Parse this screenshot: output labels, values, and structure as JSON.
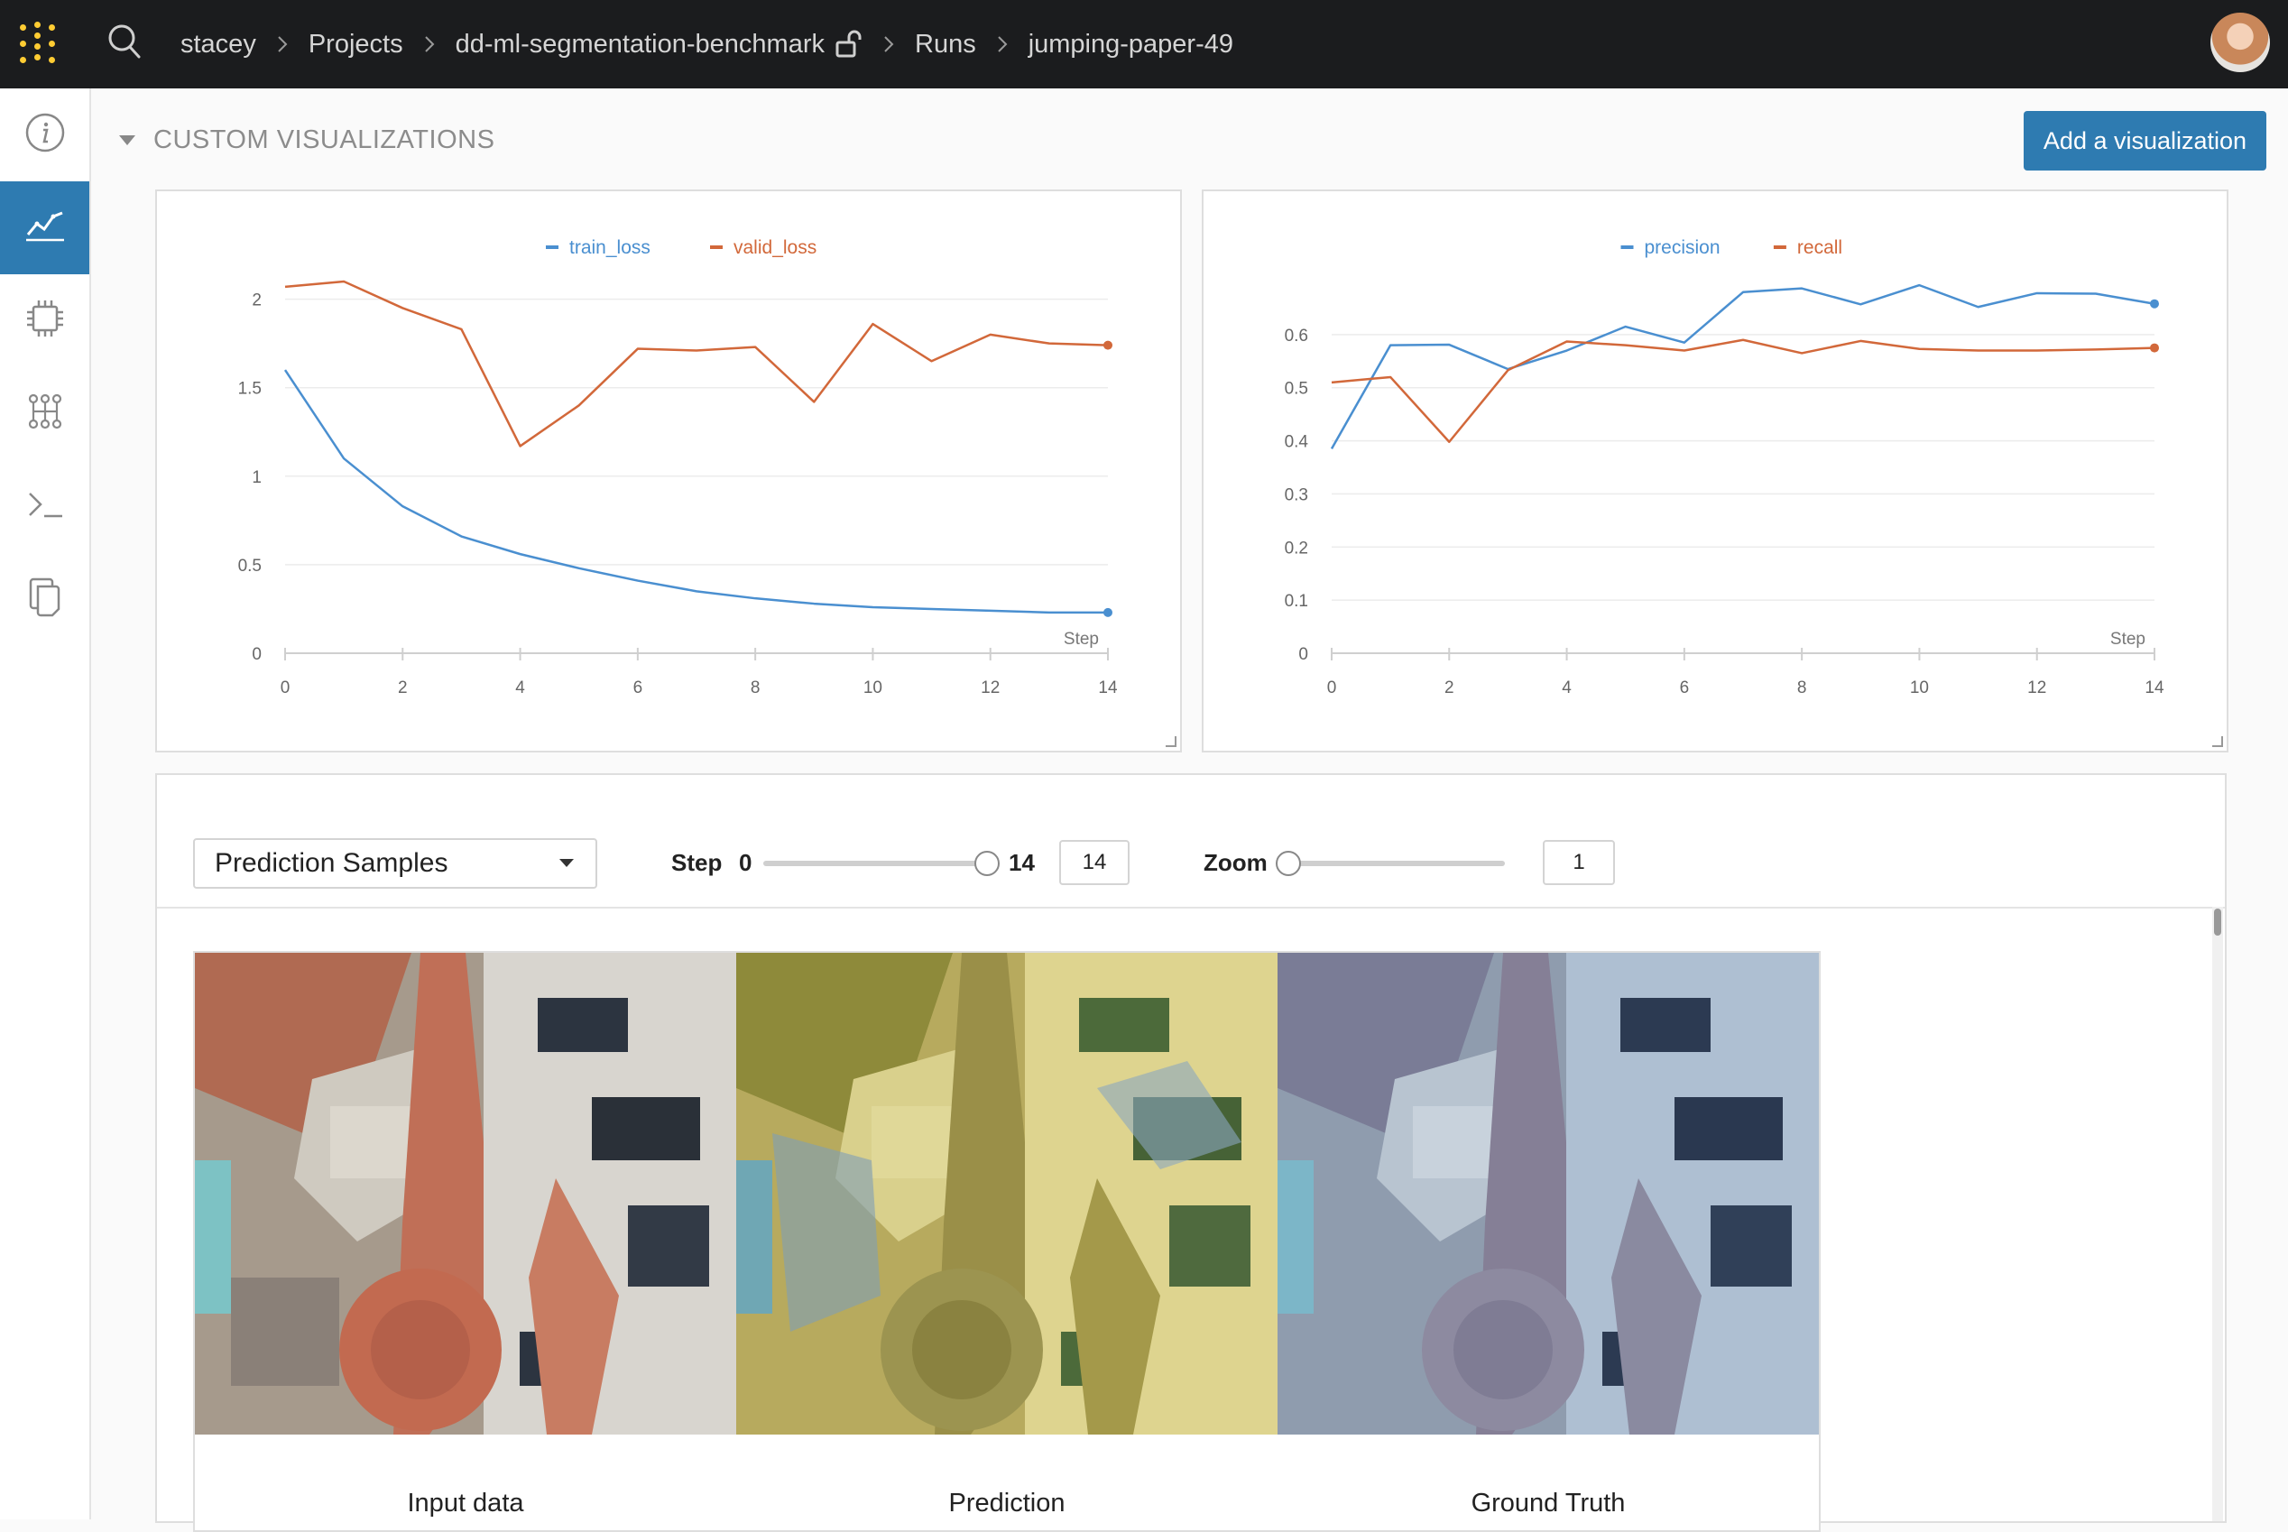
{
  "breadcrumb": [
    "stacey",
    "Projects",
    "dd-ml-segmentation-benchmark",
    "Runs",
    "jumping-paper-49"
  ],
  "icons": {
    "logo": "wandb-logo-icon",
    "search": "search-icon",
    "lock": "unlocked-icon",
    "sidebar": [
      "info-icon",
      "chart-icon",
      "chip-icon",
      "model-graph-icon",
      "terminal-icon",
      "files-icon"
    ]
  },
  "section": {
    "title": "CUSTOM VISUALIZATIONS",
    "add_button": "Add a visualization"
  },
  "colors": {
    "blue": "#4a8fd0",
    "orange": "#d2683a",
    "accent": "#2e7bb1",
    "topbar": "#1b1c1e"
  },
  "chart_data": [
    {
      "type": "line",
      "xlabel": "Step",
      "xlim": [
        0,
        14
      ],
      "ylim": [
        0,
        2.1
      ],
      "yticks": [
        0,
        0.5,
        1,
        1.5,
        2
      ],
      "xticks": [
        0,
        2,
        4,
        6,
        8,
        10,
        12,
        14
      ],
      "x": [
        0,
        1,
        2,
        3,
        4,
        5,
        6,
        7,
        8,
        9,
        10,
        11,
        12,
        13,
        14
      ],
      "series": [
        {
          "name": "train_loss",
          "color": "#4a8fd0",
          "values": [
            1.6,
            1.1,
            0.83,
            0.66,
            0.56,
            0.48,
            0.41,
            0.35,
            0.31,
            0.28,
            0.26,
            0.25,
            0.24,
            0.23,
            0.23
          ]
        },
        {
          "name": "valid_loss",
          "color": "#d2683a",
          "values": [
            2.07,
            2.1,
            1.95,
            1.83,
            1.17,
            1.4,
            1.72,
            1.71,
            1.73,
            1.42,
            1.86,
            1.65,
            1.8,
            1.75,
            1.74
          ]
        }
      ]
    },
    {
      "type": "line",
      "xlabel": "Step",
      "xlim": [
        0,
        14
      ],
      "ylim": [
        0,
        0.7
      ],
      "yticks": [
        0,
        0.1,
        0.2,
        0.3,
        0.4,
        0.5,
        0.6
      ],
      "xticks": [
        0,
        2,
        4,
        6,
        8,
        10,
        12,
        14
      ],
      "x": [
        0,
        1,
        2,
        3,
        4,
        5,
        6,
        7,
        8,
        9,
        10,
        11,
        12,
        13,
        14
      ],
      "series": [
        {
          "name": "precision",
          "color": "#4a8fd0",
          "values": [
            0.385,
            0.58,
            0.581,
            0.535,
            0.57,
            0.615,
            0.585,
            0.68,
            0.687,
            0.657,
            0.693,
            0.652,
            0.678,
            0.677,
            0.658
          ]
        },
        {
          "name": "recall",
          "color": "#d2683a",
          "values": [
            0.51,
            0.52,
            0.398,
            0.533,
            0.587,
            0.58,
            0.57,
            0.59,
            0.565,
            0.588,
            0.573,
            0.57,
            0.57,
            0.572,
            0.575
          ]
        }
      ]
    }
  ],
  "media": {
    "select_value": "Prediction Samples",
    "step": {
      "label": "Step",
      "min": "0",
      "max": "14",
      "value": "14",
      "fraction": 1.0
    },
    "zoom": {
      "label": "Zoom",
      "value": "1",
      "fraction": 0.0
    },
    "captions": [
      "Input data",
      "Prediction",
      "Ground Truth"
    ]
  }
}
